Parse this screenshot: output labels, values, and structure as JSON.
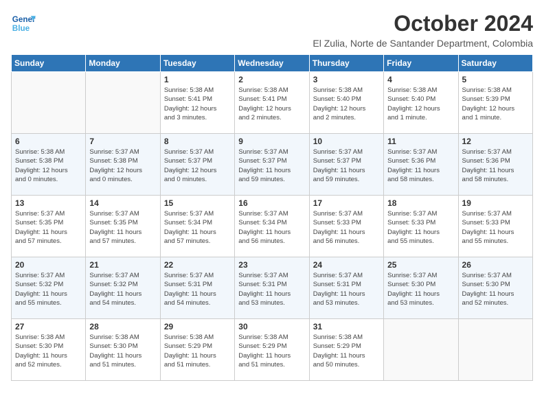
{
  "logo": {
    "line1": "General",
    "line2": "Blue"
  },
  "title": "October 2024",
  "location": "El Zulia, Norte de Santander Department, Colombia",
  "weekdays": [
    "Sunday",
    "Monday",
    "Tuesday",
    "Wednesday",
    "Thursday",
    "Friday",
    "Saturday"
  ],
  "weeks": [
    [
      {
        "day": "",
        "info": ""
      },
      {
        "day": "",
        "info": ""
      },
      {
        "day": "1",
        "info": "Sunrise: 5:38 AM\nSunset: 5:41 PM\nDaylight: 12 hours\nand 3 minutes."
      },
      {
        "day": "2",
        "info": "Sunrise: 5:38 AM\nSunset: 5:41 PM\nDaylight: 12 hours\nand 2 minutes."
      },
      {
        "day": "3",
        "info": "Sunrise: 5:38 AM\nSunset: 5:40 PM\nDaylight: 12 hours\nand 2 minutes."
      },
      {
        "day": "4",
        "info": "Sunrise: 5:38 AM\nSunset: 5:40 PM\nDaylight: 12 hours\nand 1 minute."
      },
      {
        "day": "5",
        "info": "Sunrise: 5:38 AM\nSunset: 5:39 PM\nDaylight: 12 hours\nand 1 minute."
      }
    ],
    [
      {
        "day": "6",
        "info": "Sunrise: 5:38 AM\nSunset: 5:38 PM\nDaylight: 12 hours\nand 0 minutes."
      },
      {
        "day": "7",
        "info": "Sunrise: 5:37 AM\nSunset: 5:38 PM\nDaylight: 12 hours\nand 0 minutes."
      },
      {
        "day": "8",
        "info": "Sunrise: 5:37 AM\nSunset: 5:37 PM\nDaylight: 12 hours\nand 0 minutes."
      },
      {
        "day": "9",
        "info": "Sunrise: 5:37 AM\nSunset: 5:37 PM\nDaylight: 11 hours\nand 59 minutes."
      },
      {
        "day": "10",
        "info": "Sunrise: 5:37 AM\nSunset: 5:37 PM\nDaylight: 11 hours\nand 59 minutes."
      },
      {
        "day": "11",
        "info": "Sunrise: 5:37 AM\nSunset: 5:36 PM\nDaylight: 11 hours\nand 58 minutes."
      },
      {
        "day": "12",
        "info": "Sunrise: 5:37 AM\nSunset: 5:36 PM\nDaylight: 11 hours\nand 58 minutes."
      }
    ],
    [
      {
        "day": "13",
        "info": "Sunrise: 5:37 AM\nSunset: 5:35 PM\nDaylight: 11 hours\nand 57 minutes."
      },
      {
        "day": "14",
        "info": "Sunrise: 5:37 AM\nSunset: 5:35 PM\nDaylight: 11 hours\nand 57 minutes."
      },
      {
        "day": "15",
        "info": "Sunrise: 5:37 AM\nSunset: 5:34 PM\nDaylight: 11 hours\nand 57 minutes."
      },
      {
        "day": "16",
        "info": "Sunrise: 5:37 AM\nSunset: 5:34 PM\nDaylight: 11 hours\nand 56 minutes."
      },
      {
        "day": "17",
        "info": "Sunrise: 5:37 AM\nSunset: 5:33 PM\nDaylight: 11 hours\nand 56 minutes."
      },
      {
        "day": "18",
        "info": "Sunrise: 5:37 AM\nSunset: 5:33 PM\nDaylight: 11 hours\nand 55 minutes."
      },
      {
        "day": "19",
        "info": "Sunrise: 5:37 AM\nSunset: 5:33 PM\nDaylight: 11 hours\nand 55 minutes."
      }
    ],
    [
      {
        "day": "20",
        "info": "Sunrise: 5:37 AM\nSunset: 5:32 PM\nDaylight: 11 hours\nand 55 minutes."
      },
      {
        "day": "21",
        "info": "Sunrise: 5:37 AM\nSunset: 5:32 PM\nDaylight: 11 hours\nand 54 minutes."
      },
      {
        "day": "22",
        "info": "Sunrise: 5:37 AM\nSunset: 5:31 PM\nDaylight: 11 hours\nand 54 minutes."
      },
      {
        "day": "23",
        "info": "Sunrise: 5:37 AM\nSunset: 5:31 PM\nDaylight: 11 hours\nand 53 minutes."
      },
      {
        "day": "24",
        "info": "Sunrise: 5:37 AM\nSunset: 5:31 PM\nDaylight: 11 hours\nand 53 minutes."
      },
      {
        "day": "25",
        "info": "Sunrise: 5:37 AM\nSunset: 5:30 PM\nDaylight: 11 hours\nand 53 minutes."
      },
      {
        "day": "26",
        "info": "Sunrise: 5:37 AM\nSunset: 5:30 PM\nDaylight: 11 hours\nand 52 minutes."
      }
    ],
    [
      {
        "day": "27",
        "info": "Sunrise: 5:38 AM\nSunset: 5:30 PM\nDaylight: 11 hours\nand 52 minutes."
      },
      {
        "day": "28",
        "info": "Sunrise: 5:38 AM\nSunset: 5:30 PM\nDaylight: 11 hours\nand 51 minutes."
      },
      {
        "day": "29",
        "info": "Sunrise: 5:38 AM\nSunset: 5:29 PM\nDaylight: 11 hours\nand 51 minutes."
      },
      {
        "day": "30",
        "info": "Sunrise: 5:38 AM\nSunset: 5:29 PM\nDaylight: 11 hours\nand 51 minutes."
      },
      {
        "day": "31",
        "info": "Sunrise: 5:38 AM\nSunset: 5:29 PM\nDaylight: 11 hours\nand 50 minutes."
      },
      {
        "day": "",
        "info": ""
      },
      {
        "day": "",
        "info": ""
      }
    ]
  ]
}
